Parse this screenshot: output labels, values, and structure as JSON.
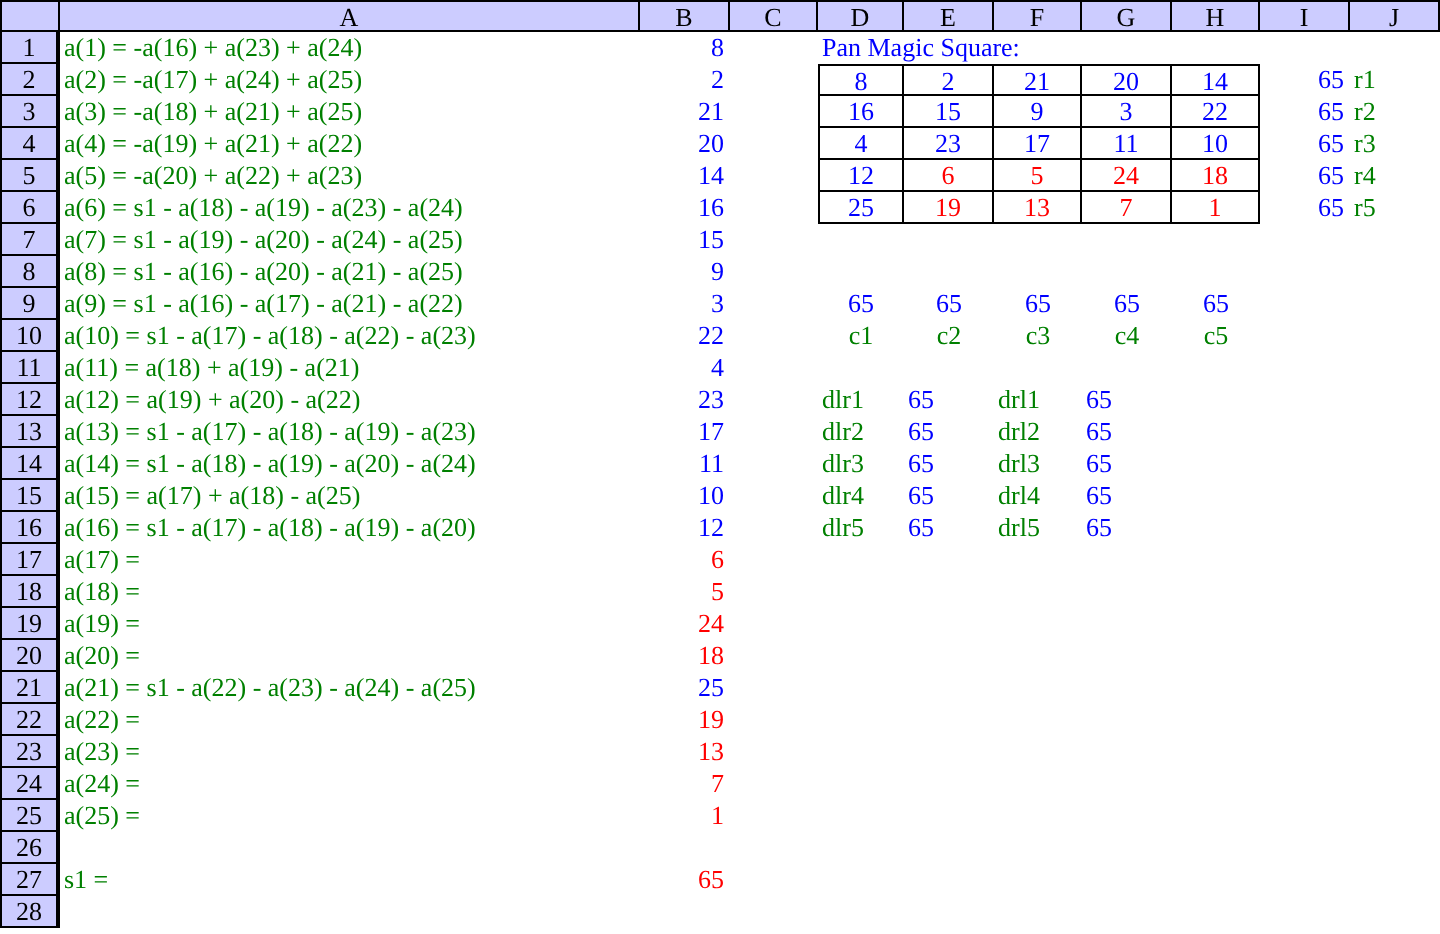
{
  "columns": [
    "A",
    "B",
    "C",
    "D",
    "E",
    "F",
    "G",
    "H",
    "I",
    "J"
  ],
  "row_numbers": [
    "1",
    "2",
    "3",
    "4",
    "5",
    "6",
    "7",
    "8",
    "9",
    "10",
    "11",
    "12",
    "13",
    "14",
    "15",
    "16",
    "17",
    "18",
    "19",
    "20",
    "21",
    "22",
    "23",
    "24",
    "25",
    "26",
    "27",
    "28"
  ],
  "formulas": [
    {
      "text": "a(1) = -a(16) + a(23) + a(24)",
      "value": "8",
      "kind": "derived"
    },
    {
      "text": "a(2) = -a(17) + a(24) + a(25)",
      "value": "2",
      "kind": "derived"
    },
    {
      "text": "a(3) = -a(18) + a(21) + a(25)",
      "value": "21",
      "kind": "derived"
    },
    {
      "text": "a(4) = -a(19) + a(21) + a(22)",
      "value": "20",
      "kind": "derived"
    },
    {
      "text": "a(5) = -a(20) + a(22) + a(23)",
      "value": "14",
      "kind": "derived"
    },
    {
      "text": "a(6) = s1 - a(18) - a(19) - a(23) - a(24)",
      "value": "16",
      "kind": "derived"
    },
    {
      "text": "a(7) = s1 - a(19) - a(20) - a(24) - a(25)",
      "value": "15",
      "kind": "derived"
    },
    {
      "text": "a(8) = s1 - a(16) - a(20) - a(21) - a(25)",
      "value": "9",
      "kind": "derived"
    },
    {
      "text": "a(9) = s1 - a(16) - a(17) - a(21) - a(22)",
      "value": "3",
      "kind": "derived"
    },
    {
      "text": "a(10) = s1 - a(17) - a(18) - a(22) - a(23)",
      "value": "22",
      "kind": "derived"
    },
    {
      "text": "a(11) = a(18) + a(19) - a(21)",
      "value": "4",
      "kind": "derived"
    },
    {
      "text": "a(12) = a(19) + a(20) - a(22)",
      "value": "23",
      "kind": "derived"
    },
    {
      "text": "a(13) = s1 - a(17) - a(18) - a(19) - a(23)",
      "value": "17",
      "kind": "derived"
    },
    {
      "text": "a(14) = s1 - a(18) - a(19) - a(20) - a(24)",
      "value": "11",
      "kind": "derived"
    },
    {
      "text": "a(15) = a(17) + a(18) - a(25)",
      "value": "10",
      "kind": "derived"
    },
    {
      "text": "a(16) = s1 - a(17) - a(18) - a(19) - a(20)",
      "value": "12",
      "kind": "derived"
    },
    {
      "text": "a(17) =",
      "value": "6",
      "kind": "free"
    },
    {
      "text": "a(18) =",
      "value": "5",
      "kind": "free"
    },
    {
      "text": "a(19) =",
      "value": "24",
      "kind": "free"
    },
    {
      "text": "a(20) =",
      "value": "18",
      "kind": "free"
    },
    {
      "text": "a(21) = s1 - a(22) - a(23) - a(24) - a(25)",
      "value": "25",
      "kind": "derived"
    },
    {
      "text": "a(22) =",
      "value": "19",
      "kind": "free"
    },
    {
      "text": "a(23) =",
      "value": "13",
      "kind": "free"
    },
    {
      "text": "a(24) =",
      "value": "7",
      "kind": "free"
    },
    {
      "text": "a(25) =",
      "value": "1",
      "kind": "free"
    }
  ],
  "sum": {
    "text": "s1 =",
    "value": "65",
    "kind": "free"
  },
  "square": {
    "title": "Pan Magic Square:",
    "rows": [
      [
        {
          "value": "8",
          "kind": "derived"
        },
        {
          "value": "2",
          "kind": "derived"
        },
        {
          "value": "21",
          "kind": "derived"
        },
        {
          "value": "20",
          "kind": "derived"
        },
        {
          "value": "14",
          "kind": "derived"
        }
      ],
      [
        {
          "value": "16",
          "kind": "derived"
        },
        {
          "value": "15",
          "kind": "derived"
        },
        {
          "value": "9",
          "kind": "derived"
        },
        {
          "value": "3",
          "kind": "derived"
        },
        {
          "value": "22",
          "kind": "derived"
        }
      ],
      [
        {
          "value": "4",
          "kind": "derived"
        },
        {
          "value": "23",
          "kind": "derived"
        },
        {
          "value": "17",
          "kind": "derived"
        },
        {
          "value": "11",
          "kind": "derived"
        },
        {
          "value": "10",
          "kind": "derived"
        }
      ],
      [
        {
          "value": "12",
          "kind": "derived"
        },
        {
          "value": "6",
          "kind": "free"
        },
        {
          "value": "5",
          "kind": "free"
        },
        {
          "value": "24",
          "kind": "free"
        },
        {
          "value": "18",
          "kind": "free"
        }
      ],
      [
        {
          "value": "25",
          "kind": "derived"
        },
        {
          "value": "19",
          "kind": "free"
        },
        {
          "value": "13",
          "kind": "free"
        },
        {
          "value": "7",
          "kind": "free"
        },
        {
          "value": "1",
          "kind": "free"
        }
      ]
    ],
    "row_sums": [
      "65",
      "65",
      "65",
      "65",
      "65"
    ],
    "row_labels": [
      "r1",
      "r2",
      "r3",
      "r4",
      "r5"
    ],
    "column_sums": [
      {
        "value": "65",
        "label": "c1"
      },
      {
        "value": "65",
        "label": "c2"
      },
      {
        "value": "65",
        "label": "c3"
      },
      {
        "value": "65",
        "label": "c4"
      },
      {
        "value": "65",
        "label": "c5"
      }
    ],
    "diagonals_left_right": [
      {
        "label": "dlr1",
        "value": "65"
      },
      {
        "label": "dlr2",
        "value": "65"
      },
      {
        "label": "dlr3",
        "value": "65"
      },
      {
        "label": "dlr4",
        "value": "65"
      },
      {
        "label": "dlr5",
        "value": "65"
      }
    ],
    "diagonals_right_left": [
      {
        "label": "drl1",
        "value": "65"
      },
      {
        "label": "drl2",
        "value": "65"
      },
      {
        "label": "drl3",
        "value": "65"
      },
      {
        "label": "drl4",
        "value": "65"
      },
      {
        "label": "drl5",
        "value": "65"
      }
    ]
  }
}
